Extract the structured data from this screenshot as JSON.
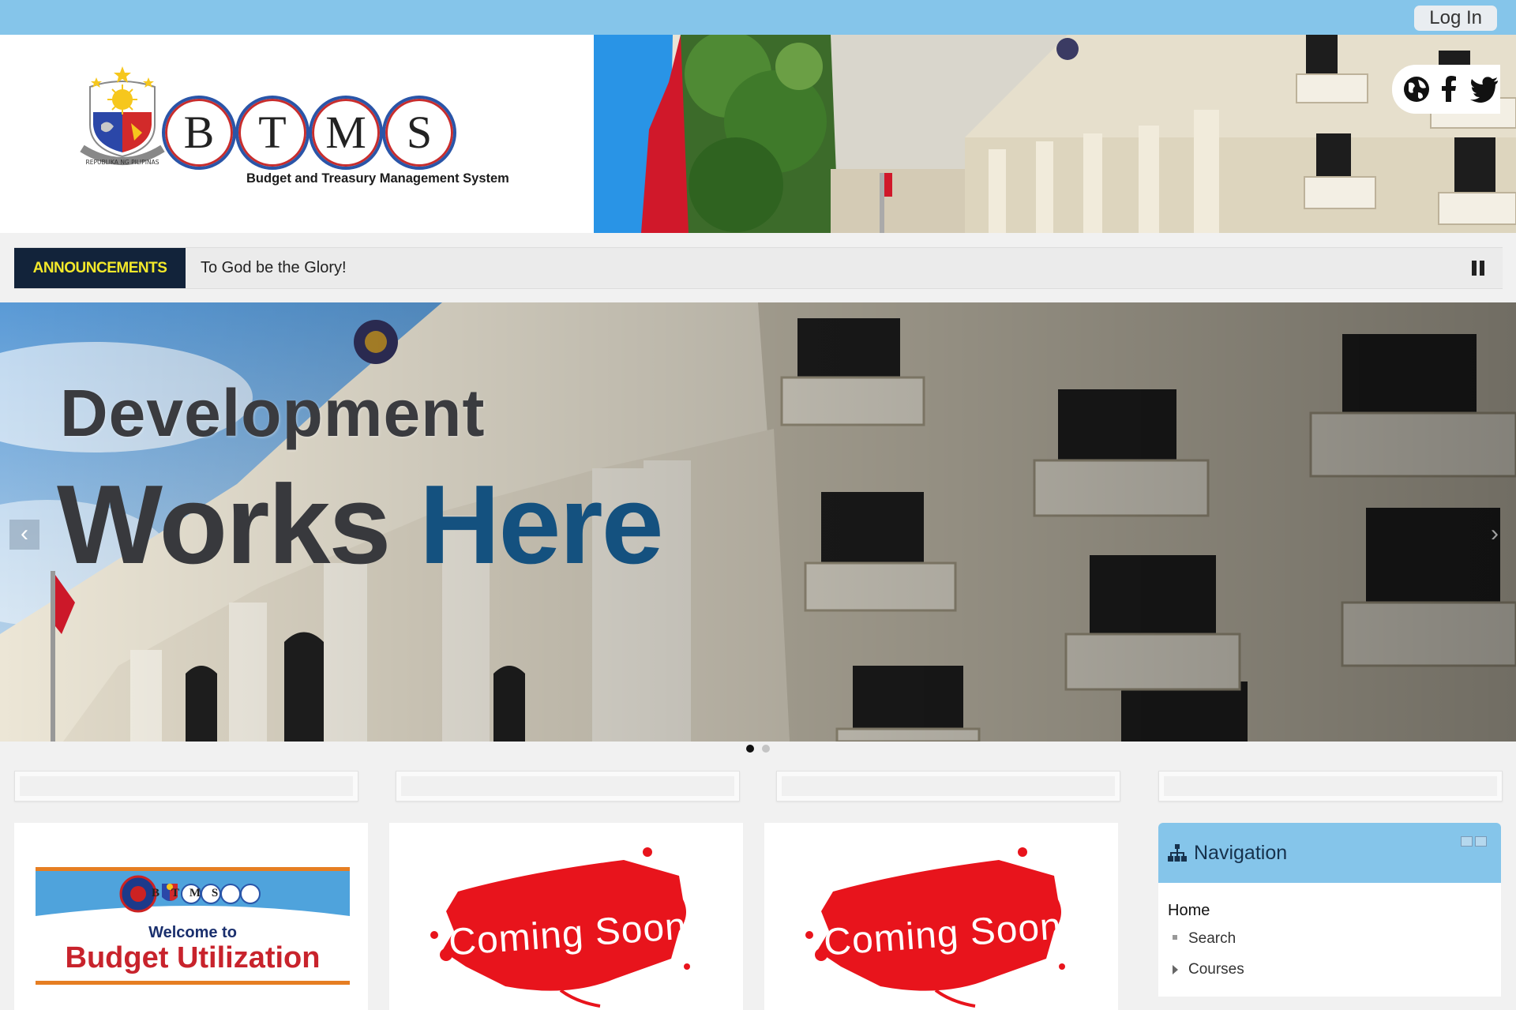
{
  "topbar": {
    "login_label": "Log In"
  },
  "header": {
    "logo_letters": [
      "B",
      "T",
      "M",
      "S"
    ],
    "logo_subtitle": "Budget and Treasury Management System",
    "seal_text": "REPUBLIKA NG PILIPINAS",
    "social_icons": [
      "globe-icon",
      "facebook-icon",
      "twitter-icon"
    ]
  },
  "announcements": {
    "label": "ANNOUNCEMENTS",
    "text": "To God be the Glory!"
  },
  "slider": {
    "line1": "Development",
    "line2_word1": "Works",
    "line2_word2": "Here",
    "prev_arrow": "‹",
    "next_arrow": "›",
    "active_index": 0,
    "slide_count": 2
  },
  "cards": [
    {
      "welcome": "Welcome to",
      "title": "Budget Utilization",
      "mini_letters": [
        "B",
        "T",
        "M",
        "S"
      ]
    },
    {
      "title": "Coming Soon"
    },
    {
      "title": "Coming Soon"
    }
  ],
  "navigation": {
    "title": "Navigation",
    "home": "Home",
    "items": [
      "Search",
      "Courses"
    ]
  },
  "colors": {
    "topbar": "#85c5ea",
    "announce_bg": "#12233a",
    "announce_fg": "#f4e92a",
    "headline_dark": "#38393d",
    "headline_blue": "#14517f",
    "coming_soon_red": "#e8141c"
  }
}
